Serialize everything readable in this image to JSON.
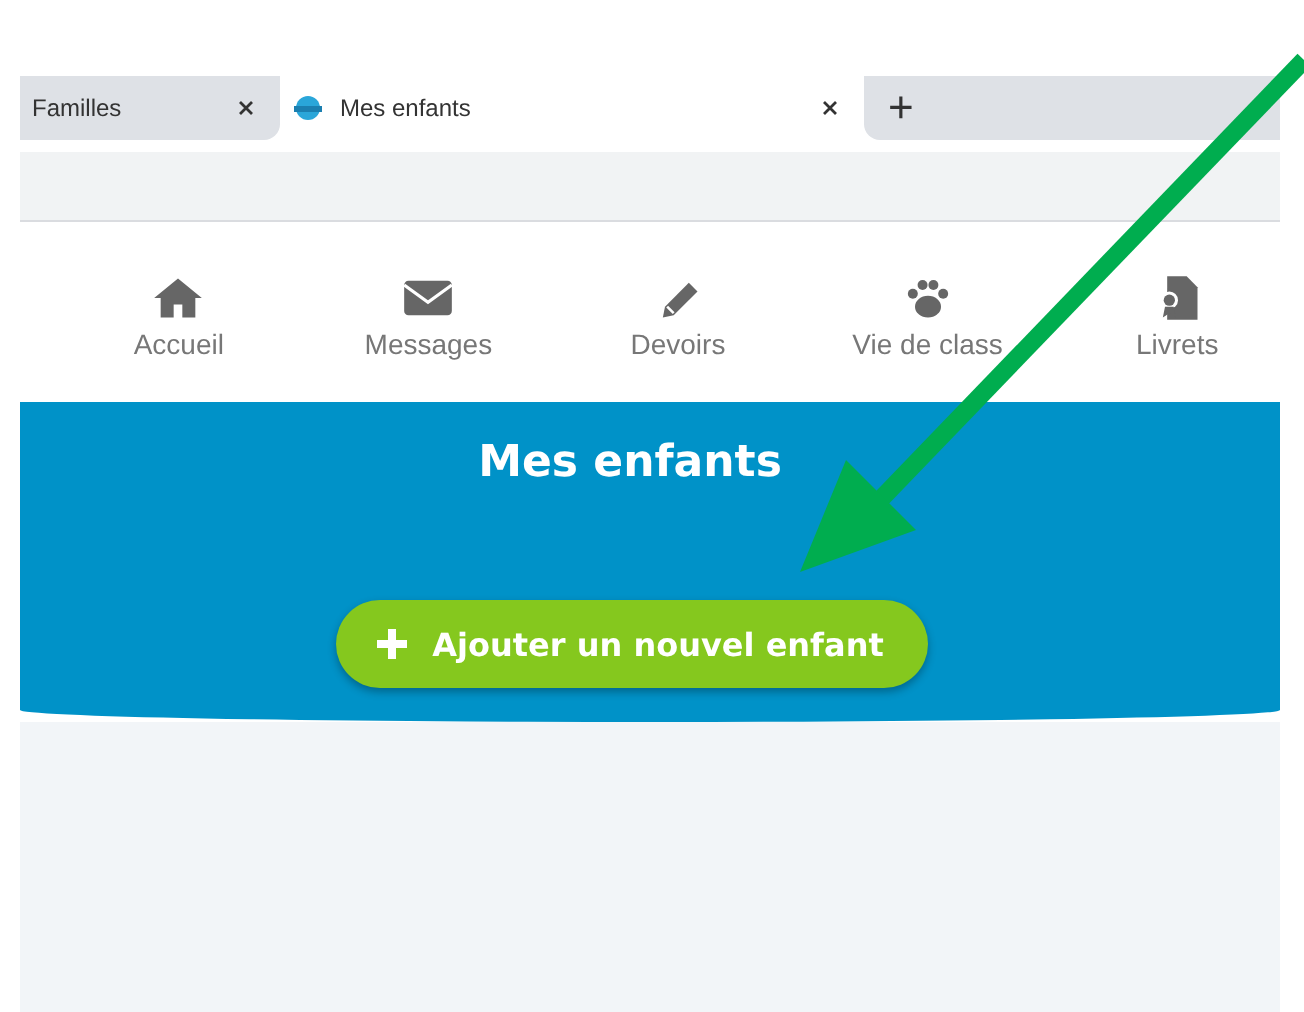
{
  "tabs": [
    {
      "label": "Familles",
      "selected": false
    },
    {
      "label": "Mes enfants",
      "selected": true
    }
  ],
  "new_tab": "+",
  "nav": [
    {
      "label": "Accueil",
      "kind": "home"
    },
    {
      "label": "Messages",
      "kind": "mail"
    },
    {
      "label": "Devoirs",
      "kind": "pencil"
    },
    {
      "label": "Vie de class",
      "kind": "paw"
    },
    {
      "label": "Livrets",
      "kind": "doc"
    }
  ],
  "banner": {
    "title": "Mes enfants",
    "button": "Ajouter un nouvel enfant"
  },
  "annotation": {
    "kind": "arrow"
  }
}
